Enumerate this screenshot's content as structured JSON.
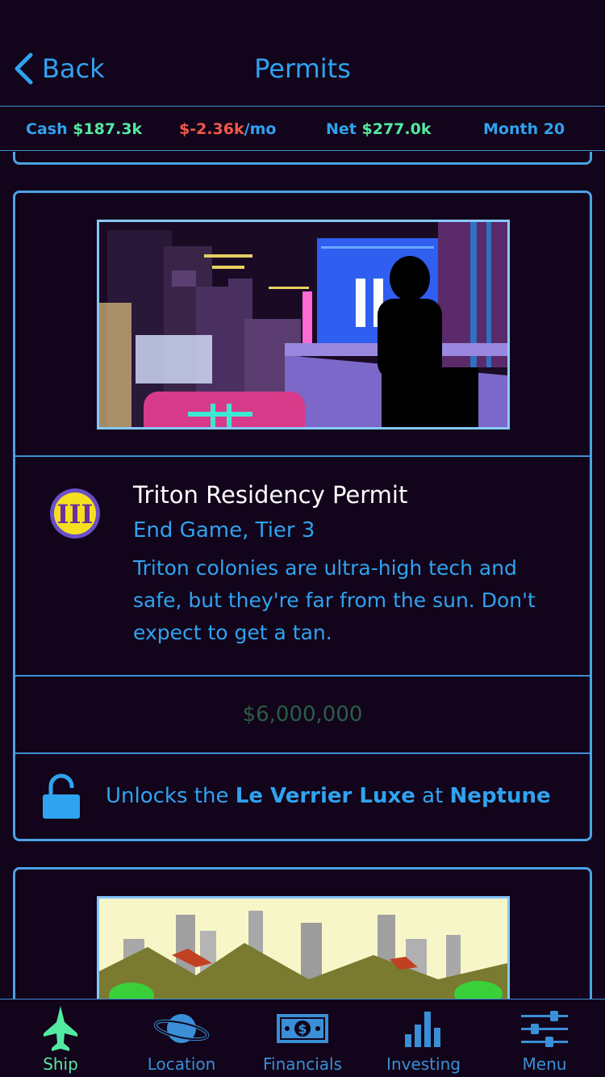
{
  "nav": {
    "back_label": "Back",
    "title": "Permits"
  },
  "stats": {
    "cash_label": "Cash ",
    "cash_value": "$187.3k",
    "burn_value": "$-2.36k",
    "burn_unit": "/mo",
    "net_label": "Net ",
    "net_value": "$277.0k",
    "month_label": "Month 20"
  },
  "permit": {
    "tier_badge": "III",
    "title": "Triton Residency Permit",
    "subtitle": "End Game, Tier 3",
    "description": "Triton colonies are ultra-high tech and safe, but they're far from the sun. Don't expect to get a tan.",
    "price": "$6,000,000",
    "unlock_prefix": "Unlocks the ",
    "unlock_item": "Le Verrier Luxe",
    "unlock_mid": " at ",
    "unlock_place": "Neptune",
    "lock_icon": "unlocked-padlock-icon"
  },
  "tabs": [
    {
      "label": "Ship",
      "icon": "ship-icon",
      "active": true
    },
    {
      "label": "Location",
      "icon": "planet-icon",
      "active": false
    },
    {
      "label": "Financials",
      "icon": "banknote-icon",
      "active": false
    },
    {
      "label": "Investing",
      "icon": "bar-chart-icon",
      "active": false
    },
    {
      "label": "Menu",
      "icon": "sliders-icon",
      "active": false
    }
  ],
  "colors": {
    "background": "#12041a",
    "accent": "#2fa3f0",
    "positive": "#54e9a2",
    "negative": "#f0584a",
    "border": "#4aa3e6",
    "price": "#2a5d45"
  }
}
